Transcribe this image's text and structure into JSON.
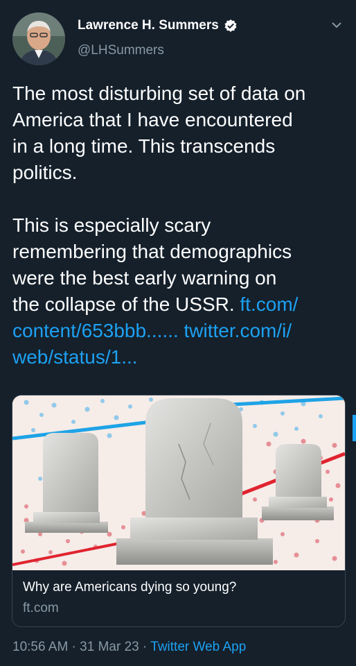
{
  "author": {
    "name": "Lawrence H. Summers",
    "handle": "@LHSummers",
    "avatar_icon": "person-avatar",
    "verified_icon": "verified-badge-icon"
  },
  "menu_icon": "chevron-down-icon",
  "tweet": {
    "paragraph1_lines": [
      "The most disturbing set of data on",
      "America that I have encountered",
      "in a long time. This transcends",
      "politics."
    ],
    "paragraph2_lines": [
      "This is especially scary",
      "remembering that demographics",
      "were the best early warning on"
    ],
    "paragraph2_last_text": "the collapse of the USSR. ",
    "link1_part1": "ft.com/",
    "link1_part2": "content/653bbb......",
    "link2_part1": "twitter.com/i/",
    "link2_part2": "web/status/1..."
  },
  "card": {
    "title": "Why are Americans dying so young?",
    "domain": "ft.com"
  },
  "meta": {
    "time": "10:56 AM",
    "separator1": " · ",
    "date": "31 Mar 23",
    "separator2": " · ",
    "source": "Twitter Web App"
  },
  "colors": {
    "background": "#15202b",
    "link": "#1da1f2",
    "secondary_text": "#8899a6",
    "chart_red": "#e0232f",
    "chart_blue": "#1ea3e6"
  }
}
